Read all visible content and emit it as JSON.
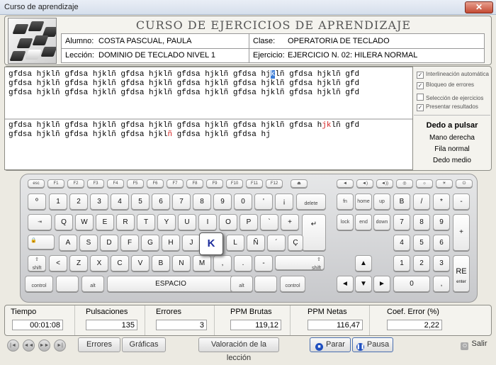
{
  "window": {
    "title": "Curso de aprendizaje",
    "close_glyph": "✕"
  },
  "course_title": "CURSO DE EJERCICIOS DE APRENDIZAJE",
  "info": {
    "alumno_label": "Alumno:",
    "alumno_value": "COSTA PASCUAL, PAULA",
    "clase_label": "Clase:",
    "clase_value": "OPERATORIA DE TECLADO",
    "leccion_label": "Lección:",
    "leccion_value": "DOMINIO DE TECLADO NIVEL 1",
    "ejercicio_label": "Ejercicio:",
    "ejercicio_value": "EJERCICIO N. 02: HILERA NORMAL"
  },
  "exercise": {
    "model_line1_a": "gfdsa hjklñ gfdsa hjklñ gfdsa hjklñ gfdsa hjklñ gfdsa hj",
    "model_line1_cursor": "k",
    "model_line1_b": "lñ gfdsa hjklñ gfd",
    "model_line2": "gfdsa hjklñ gfdsa hjklñ gfdsa hjklñ gfdsa hjklñ gfdsa hjklñ gfdsa hjklñ gfd",
    "model_line3": "gfdsa hjklñ gfdsa hjklñ gfdsa hjklñ gfdsa hjklñ gfdsa hjklñ gfdsa hjklñ gfd",
    "typed_line1_a": "gfdsa hjklñ gfdsa hjklñ gfdsa hjklñ gfdsa hjklñ gfdsa hjklñ gfdsa h",
    "typed_line1_err": "jk",
    "typed_line1_b": "lñ gfd",
    "typed_line2_a": "gfdsa hjklñ gfdsa hjklñ gfdsa hjkl",
    "typed_line2_err": "ñ",
    "typed_line2_b": " gfdsa hjklñ gfdsa hj"
  },
  "options": {
    "interlineacion": "Interlineación automática",
    "bloqueo": "Bloqueo de errores",
    "seleccion": "Selección de ejercicios",
    "presentar": "Presentar resultados",
    "check_mark": "✓"
  },
  "finger": {
    "heading": "Dedo a pulsar",
    "hand": "Mano derecha",
    "row": "Fila normal",
    "finger": "Dedo medio"
  },
  "keyboard": {
    "active_key": "K",
    "space": "ESPACIO",
    "enter": "RE",
    "enter_sub": "enter"
  },
  "stats": {
    "tiempo_label": "Tiempo",
    "tiempo": "00:01:08",
    "pulsaciones_label": "Pulsaciones",
    "pulsaciones": "135",
    "errores_label": "Errores",
    "errores": "3",
    "ppm_brutas_label": "PPM Brutas",
    "ppm_brutas": "119,12",
    "ppm_netas_label": "PPM Netas",
    "ppm_netas": "116,47",
    "coef_label": "Coef. Error (%)",
    "coef": "2,22"
  },
  "buttons": {
    "errores": "Errores",
    "graficas": "Gráficas",
    "valoracion": "Valoración de la lección",
    "parar": "Parar",
    "pausa": "Pausa",
    "salir": "Salir"
  }
}
